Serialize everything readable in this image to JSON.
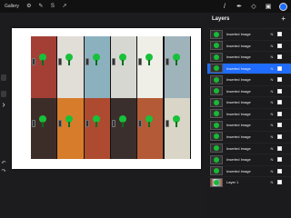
{
  "topbar": {
    "gallery_label": "Gallery",
    "left_icons": [
      "wrench-icon",
      "wand-icon",
      "selection-icon",
      "transform-icon"
    ],
    "right_icons": [
      "brush-icon",
      "smudge-icon",
      "eraser-icon",
      "layers-icon"
    ],
    "selected_color": "#1d6bff"
  },
  "sidebar": {
    "chevron_label": "›",
    "undo_label": "↶",
    "redo_label": "↷"
  },
  "layers_panel": {
    "title": "Layers",
    "add_label": "+",
    "items": [
      {
        "label": "Inserted Image",
        "mode": "N",
        "active": false
      },
      {
        "label": "Inserted Image",
        "mode": "N",
        "active": false
      },
      {
        "label": "Inserted Image",
        "mode": "N",
        "active": false
      },
      {
        "label": "Inserted Image",
        "mode": "N",
        "active": true
      },
      {
        "label": "Inserted Image",
        "mode": "N",
        "active": false
      },
      {
        "label": "Inserted Image",
        "mode": "N",
        "active": false
      },
      {
        "label": "Inserted Image",
        "mode": "N",
        "active": false
      },
      {
        "label": "Inserted Image",
        "mode": "N",
        "active": false
      },
      {
        "label": "Inserted Image",
        "mode": "N",
        "active": false
      },
      {
        "label": "Inserted Image",
        "mode": "N",
        "active": false
      },
      {
        "label": "Inserted Image",
        "mode": "N",
        "active": false
      },
      {
        "label": "Inserted Image",
        "mode": "N",
        "active": false
      },
      {
        "label": "Inserted Image",
        "mode": "N",
        "active": false
      },
      {
        "label": "Layer 1",
        "mode": "N",
        "active": false
      }
    ]
  },
  "canvas": {
    "locker_colors": [
      "#a33f35",
      "#e1ddd7",
      "#8bb1bf",
      "#d7d7d2",
      "#efefe8",
      "#9fb3bb",
      "#3d2d28",
      "#d77c2a",
      "#ae4a2f",
      "#3a2f2c",
      "#b45a36",
      "#d9d6c8"
    ]
  }
}
